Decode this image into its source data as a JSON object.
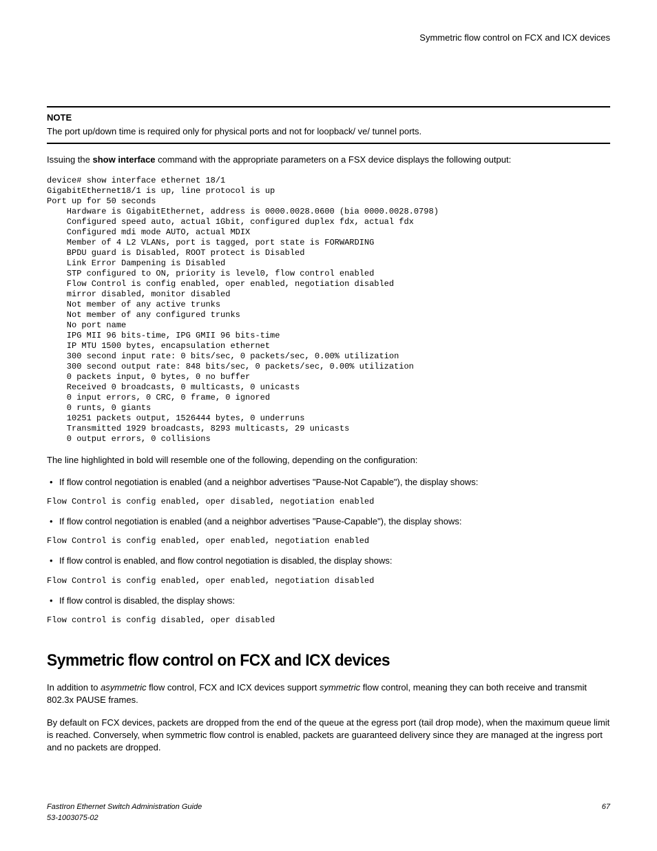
{
  "header": {
    "running_title": "Symmetric flow control on FCX and ICX devices"
  },
  "note": {
    "label": "NOTE",
    "text": "The port up/down time is required only for physical ports and not for loopback/ ve/ tunnel ports."
  },
  "intro": {
    "pre": "Issuing the ",
    "cmd": "show interface",
    "post": " command with the appropriate parameters on a FSX device displays the following output:"
  },
  "code_block": "device# show interface ethernet 18/1\nGigabitEthernet18/1 is up, line protocol is up\nPort up for 50 seconds\n    Hardware is GigabitEthernet, address is 0000.0028.0600 (bia 0000.0028.0798)\n    Configured speed auto, actual 1Gbit, configured duplex fdx, actual fdx\n    Configured mdi mode AUTO, actual MDIX\n    Member of 4 L2 VLANs, port is tagged, port state is FORWARDING\n    BPDU guard is Disabled, ROOT protect is Disabled\n    Link Error Dampening is Disabled\n    STP configured to ON, priority is level0, flow control enabled\n    Flow Control is config enabled, oper enabled, negotiation disabled\n    mirror disabled, monitor disabled\n    Not member of any active trunks\n    Not member of any configured trunks\n    No port name\n    IPG MII 96 bits-time, IPG GMII 96 bits-time\n    IP MTU 1500 bytes, encapsulation ethernet\n    300 second input rate: 0 bits/sec, 0 packets/sec, 0.00% utilization\n    300 second output rate: 848 bits/sec, 0 packets/sec, 0.00% utilization\n    0 packets input, 0 bytes, 0 no buffer\n    Received 0 broadcasts, 0 multicasts, 0 unicasts\n    0 input errors, 0 CRC, 0 frame, 0 ignored\n    0 runts, 0 giants\n    10251 packets output, 1526444 bytes, 0 underruns\n    Transmitted 1929 broadcasts, 8293 multicasts, 29 unicasts\n    0 output errors, 0 collisions",
  "after_code": "The line highlighted in bold will resemble one of the following, depending on the configuration:",
  "cases": [
    {
      "desc": "If flow control negotiation is enabled (and a neighbor advertises \"Pause-Not Capable\"), the display shows:",
      "out": "Flow Control is config enabled, oper disabled, negotiation enabled"
    },
    {
      "desc": "If flow control negotiation is enabled (and a neighbor advertises \"Pause-Capable\"), the display shows:",
      "out": "Flow Control is config enabled, oper enabled, negotiation enabled"
    },
    {
      "desc": "If flow control is enabled, and flow control negotiation is disabled, the display shows:",
      "out": "Flow Control is config enabled, oper enabled, negotiation disabled"
    },
    {
      "desc": "If flow control is disabled, the display shows:",
      "out": "Flow control is config disabled, oper disabled"
    }
  ],
  "section": {
    "title": "Symmetric flow control on FCX and ICX devices",
    "p1_a": "In addition to ",
    "p1_i1": "asymmetric",
    "p1_b": " flow control, FCX and ICX devices support ",
    "p1_i2": "symmetric",
    "p1_c": " flow control, meaning they can both receive and transmit 802.3x PAUSE frames.",
    "p2": "By default on FCX devices, packets are dropped from the end of the queue at the egress port (tail drop mode), when the maximum queue limit is reached. Conversely, when symmetric flow control is enabled, packets are guaranteed delivery since they are managed at the ingress port and no packets are dropped."
  },
  "footer": {
    "book": "FastIron Ethernet Switch Administration Guide",
    "docnum": "53-1003075-02",
    "page": "67"
  }
}
